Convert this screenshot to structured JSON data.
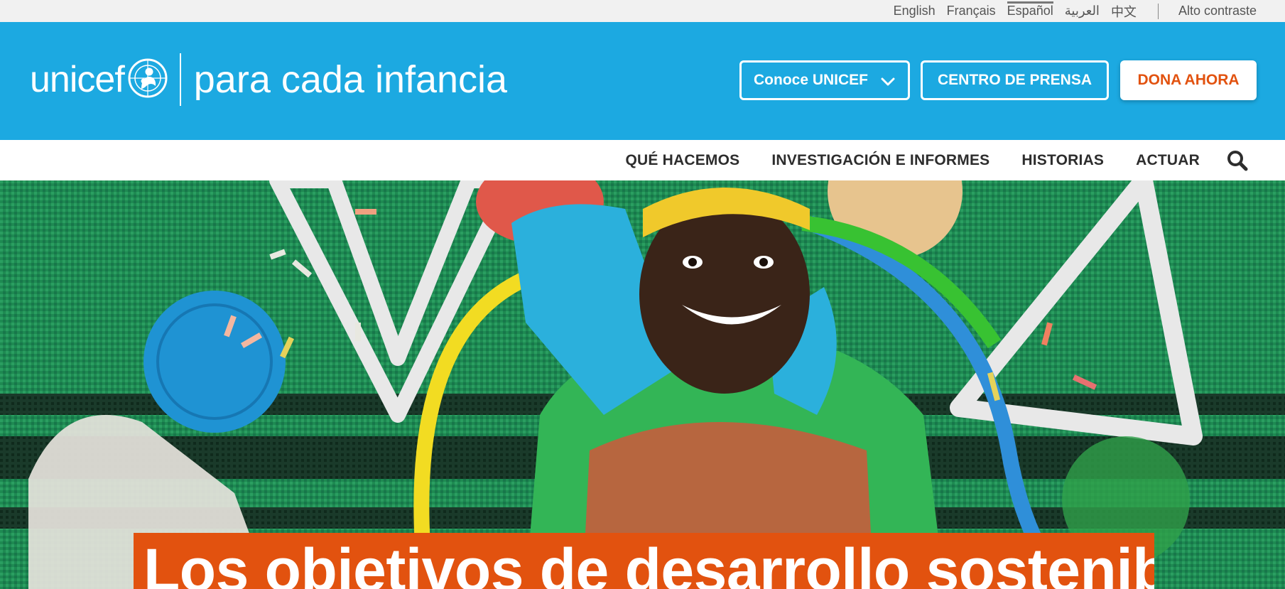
{
  "topbar": {
    "languages": [
      "English",
      "Français",
      "Español",
      "العربية",
      "中文"
    ],
    "active_language": "Español",
    "high_contrast": "Alto contraste"
  },
  "header": {
    "logo_word": "unicef",
    "tagline": "para cada infancia",
    "know_unicef": "Conoce UNICEF",
    "press_center": "CENTRO DE PRENSA",
    "donate": "DONA AHORA"
  },
  "nav": {
    "items": [
      "QUÉ HACEMOS",
      "INVESTIGACIÓN E INFORMES",
      "HISTORIAS",
      "ACTUAR"
    ],
    "search_icon": "search-icon"
  },
  "hero": {
    "headline": "Los objetivos de desarrollo sostenible"
  },
  "colors": {
    "brand_blue": "#1ca9e1",
    "donate_orange": "#e2520f",
    "headline_band": "#e2520f"
  }
}
